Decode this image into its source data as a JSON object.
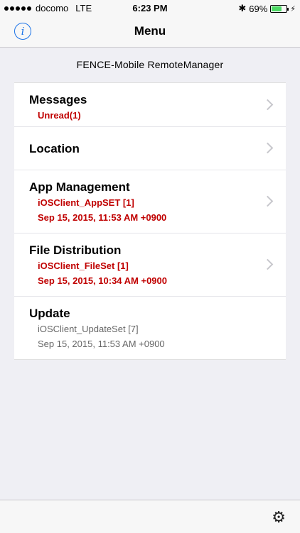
{
  "status": {
    "carrier": "docomo",
    "network": "LTE",
    "time": "6:23 PM",
    "battery": "69%",
    "battery_level": 0.69
  },
  "nav": {
    "title": "Menu"
  },
  "app": {
    "subtitle": "FENCE-Mobile RemoteManager"
  },
  "menu": {
    "messages": {
      "title": "Messages",
      "sub1": "Unread(1)"
    },
    "location": {
      "title": "Location"
    },
    "app_management": {
      "title": "App Management",
      "sub1": "iOSClient_AppSET [1]",
      "sub2": "Sep 15, 2015, 11:53 AM +0900"
    },
    "file_distribution": {
      "title": "File Distribution",
      "sub1": "iOSClient_FileSet [1]",
      "sub2": "Sep 15, 2015, 10:34 AM +0900"
    },
    "update": {
      "title": "Update",
      "sub1": "iOSClient_UpdateSet [7]",
      "sub2": "Sep 15, 2015, 11:53 AM +0900"
    }
  },
  "icons": {
    "info": "info-icon",
    "settings": "gear-icon"
  },
  "colors": {
    "accent": "#1a73e8",
    "alert": "#c00000",
    "battery": "#4cd964"
  }
}
